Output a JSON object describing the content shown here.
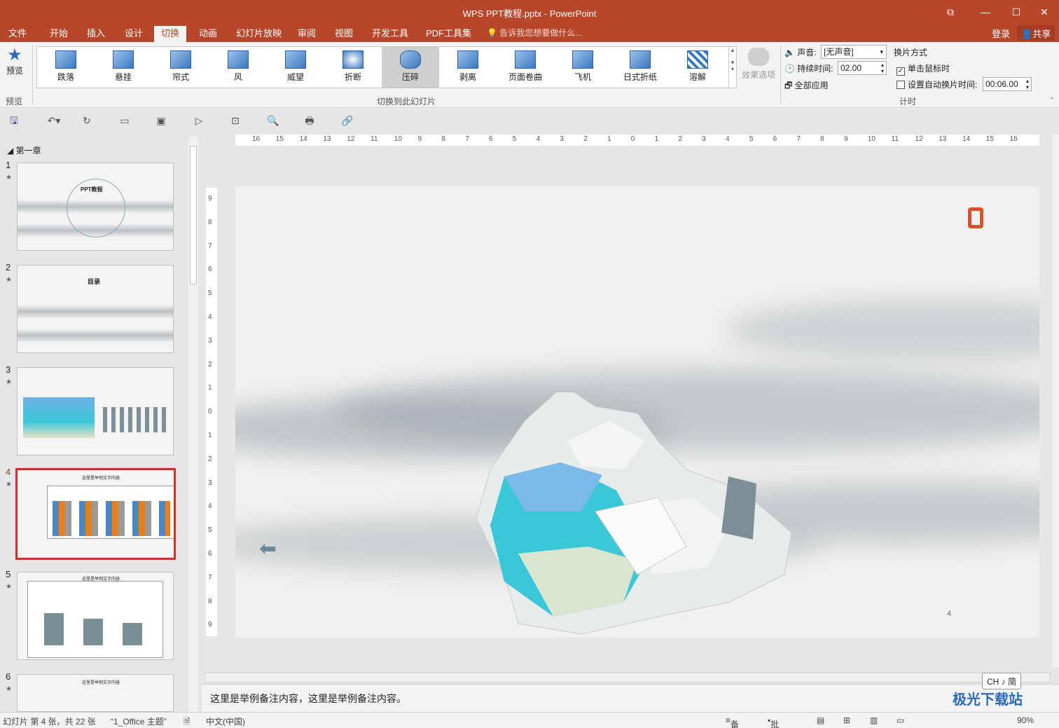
{
  "window": {
    "title": "WPS PPT教程.pptx - PowerPoint",
    "controls": [
      "⧉",
      "—",
      "☐",
      "✕"
    ]
  },
  "menu": {
    "tabs": [
      "文件",
      "开始",
      "插入",
      "设计",
      "切换",
      "动画",
      "幻灯片放映",
      "审阅",
      "视图",
      "开发工具",
      "PDF工具集"
    ],
    "active_tab": "切换",
    "tell_me": "告诉我您想要做什么...",
    "login": "登录",
    "share": "共享"
  },
  "ribbon": {
    "preview_label": "预览",
    "preview_group": "预览",
    "transitions": [
      "跌落",
      "悬挂",
      "帘式",
      "风",
      "威望",
      "折断",
      "压碎",
      "剥离",
      "页面卷曲",
      "飞机",
      "日式折纸",
      "溶解"
    ],
    "selected_transition": "压碎",
    "transitions_group": "切换到此幻灯片",
    "effect_options": "效果选项",
    "sound_label": "声音:",
    "sound_value": "[无声音]",
    "duration_label": "持续时间:",
    "duration_value": "02.00",
    "apply_all": "全部应用",
    "advance_title": "换片方式",
    "on_click_label": "单击鼠标时",
    "on_click_checked": true,
    "auto_advance_label": "设置自动换片时间:",
    "auto_advance_checked": false,
    "auto_advance_value": "00:06.00",
    "timing_group": "计时"
  },
  "slides_pane": {
    "section": "第一章",
    "slides": [
      {
        "num": "1",
        "title": "PPT教程"
      },
      {
        "num": "2",
        "title": "目录"
      },
      {
        "num": "3",
        "title": ""
      },
      {
        "num": "4",
        "title": "这里是举例文字内容"
      },
      {
        "num": "5",
        "title": "这里是举例文字内容"
      },
      {
        "num": "6",
        "title": "这里是举例文字内容"
      }
    ],
    "selected": "4"
  },
  "editor": {
    "ruler_h": [
      "16",
      "15",
      "14",
      "13",
      "12",
      "11",
      "10",
      "9",
      "8",
      "7",
      "6",
      "5",
      "4",
      "3",
      "2",
      "1",
      "0",
      "1",
      "2",
      "3",
      "4",
      "5",
      "6",
      "7",
      "8",
      "9",
      "10",
      "11",
      "12",
      "13",
      "14",
      "15",
      "16"
    ],
    "ruler_v": [
      "9",
      "8",
      "7",
      "6",
      "5",
      "4",
      "3",
      "2",
      "1",
      "0",
      "1",
      "2",
      "3",
      "4",
      "5",
      "6",
      "7",
      "8",
      "9"
    ],
    "slide_number": "4",
    "notes": "这里是举例备注内容，这里是举例备注内容。",
    "ime": "CH ♪ 简"
  },
  "status": {
    "slide_info": "幻灯片 第 4 张，共 22 张",
    "theme": "“1_Office 主题”",
    "language": "中文(中国)",
    "notes_btn": "备注",
    "comments_btn": "批注",
    "zoom": "90%"
  },
  "watermark": "极光下载站",
  "colors": {
    "accent": "#b7472a",
    "selection": "#c0392b"
  }
}
